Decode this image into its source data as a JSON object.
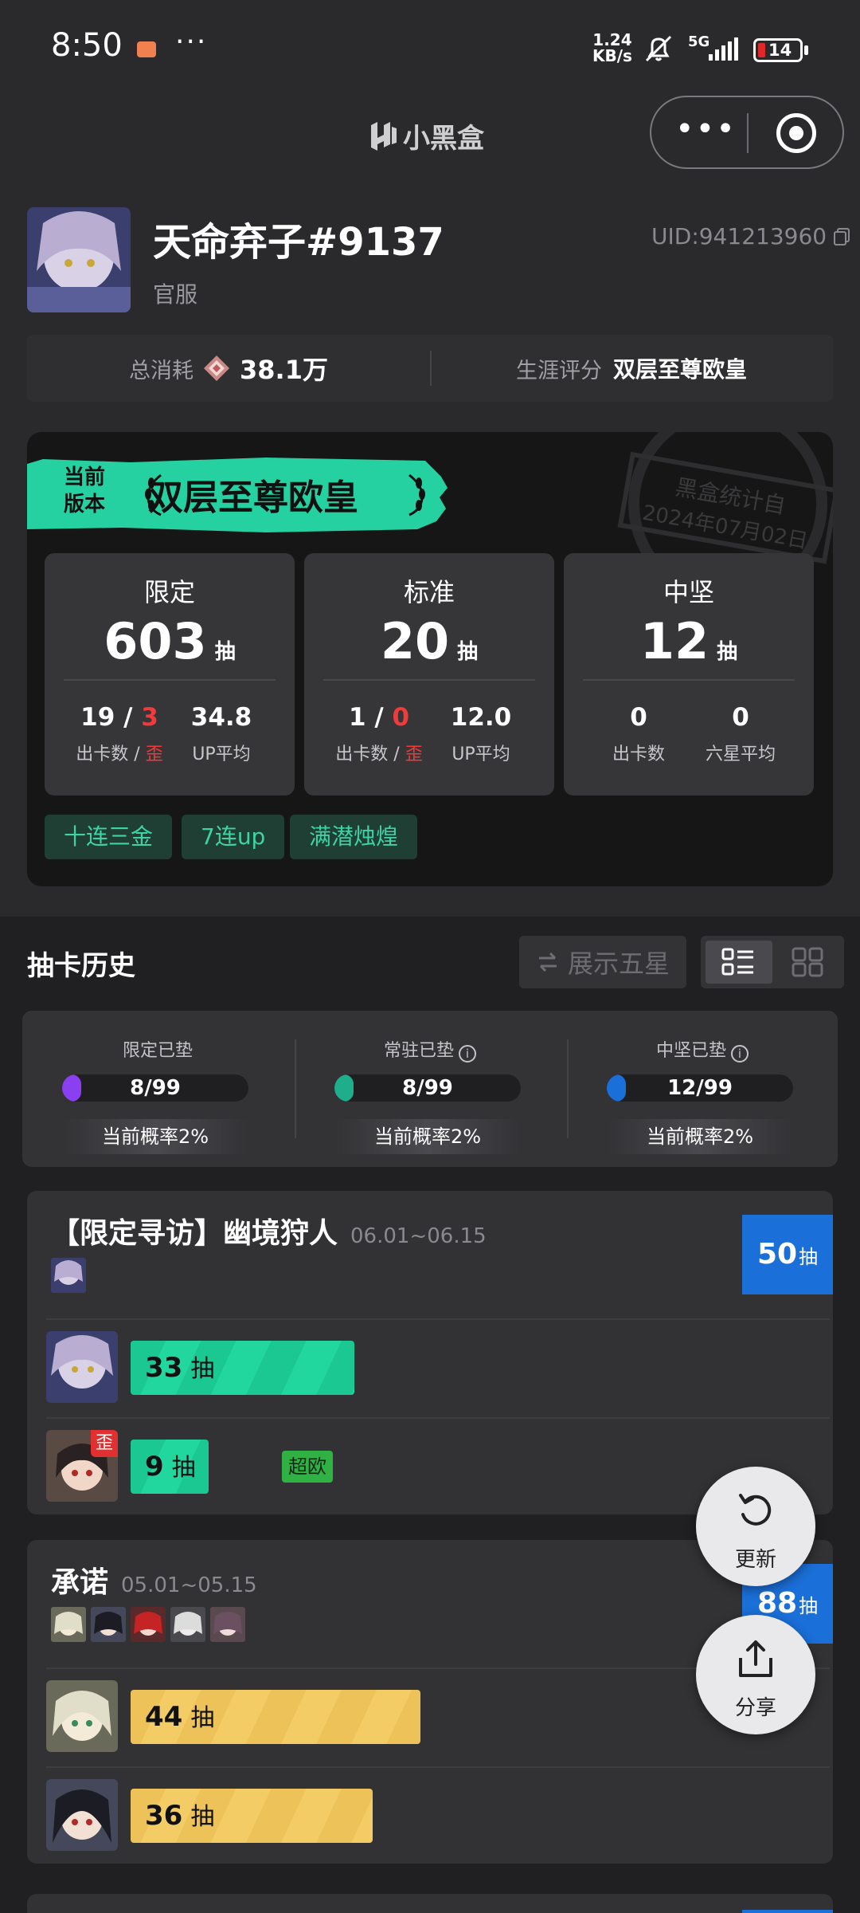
{
  "status_bar": {
    "time": "8:50",
    "more": "···",
    "speed_top": "1.24",
    "speed_bottom": "KB/s",
    "network": "5G",
    "battery": "14"
  },
  "header": {
    "app_title": "小黑盒",
    "capsule_more": "•••"
  },
  "profile": {
    "username": "天命弃子#9137",
    "server": "官服",
    "uid": "UID:941213960"
  },
  "summary": {
    "cost_label": "总消耗",
    "cost_value": "38.1万",
    "rating_label": "生涯评分",
    "rating_value": "双层至尊欧皇"
  },
  "card": {
    "ribbon_small_1": "当前",
    "ribbon_small_2": "版本",
    "ribbon_main": "双层至尊欧皇",
    "stamp_line1": "黑盒统计自",
    "stamp_line2": "2024年07月02日",
    "stats": [
      {
        "title": "限定",
        "count": "603",
        "unit": "抽",
        "a_val": "19",
        "a_slash": " / ",
        "a_red": "3",
        "a_lab": "出卡数 / ",
        "a_lab_red": "歪",
        "b_val": "34.8",
        "b_lab": "UP平均"
      },
      {
        "title": "标准",
        "count": "20",
        "unit": "抽",
        "a_val": "1",
        "a_slash": " / ",
        "a_red": "0",
        "a_lab": "出卡数 / ",
        "a_lab_red": "歪",
        "b_val": "12.0",
        "b_lab": "UP平均"
      },
      {
        "title": "中坚",
        "count": "12",
        "unit": "抽",
        "a_val": "0",
        "a_lab": "出卡数",
        "b_val": "0",
        "b_lab": "六星平均"
      }
    ],
    "tags": [
      "十连三金",
      "7连up",
      "满潜烛煌"
    ]
  },
  "history": {
    "title": "抽卡历史",
    "show_five": "展示五星",
    "pity": [
      {
        "label": "限定已垫",
        "value": "8/99",
        "fraction": 0.08,
        "color": "#8a3ff0",
        "rate": "当前概率2%"
      },
      {
        "label": "常驻已垫",
        "value": "8/99",
        "fraction": 0.08,
        "color": "#1fae8c",
        "rate": "当前概率2%"
      },
      {
        "label": "中坚已垫",
        "value": "12/99",
        "fraction": 0.12,
        "color": "#1a6fd8",
        "rate": "当前概率2%"
      }
    ],
    "banners": [
      {
        "name": "【限定寻访】幽境狩人",
        "date": "06.01~06.15",
        "total": "50",
        "unit": "抽",
        "pulls": [
          {
            "count": "33",
            "unit": "抽",
            "max": 50
          },
          {
            "count": "9",
            "unit": "抽",
            "badge": "歪",
            "chip": "超欧",
            "max": 50
          }
        ]
      },
      {
        "name": "承诺",
        "date": "05.01~05.15",
        "total": "88",
        "unit": "抽",
        "pulls": [
          {
            "count": "44",
            "unit": "抽"
          },
          {
            "count": "36",
            "unit": "抽"
          }
        ]
      }
    ]
  },
  "fab": {
    "refresh": "更新",
    "share": "分享"
  }
}
